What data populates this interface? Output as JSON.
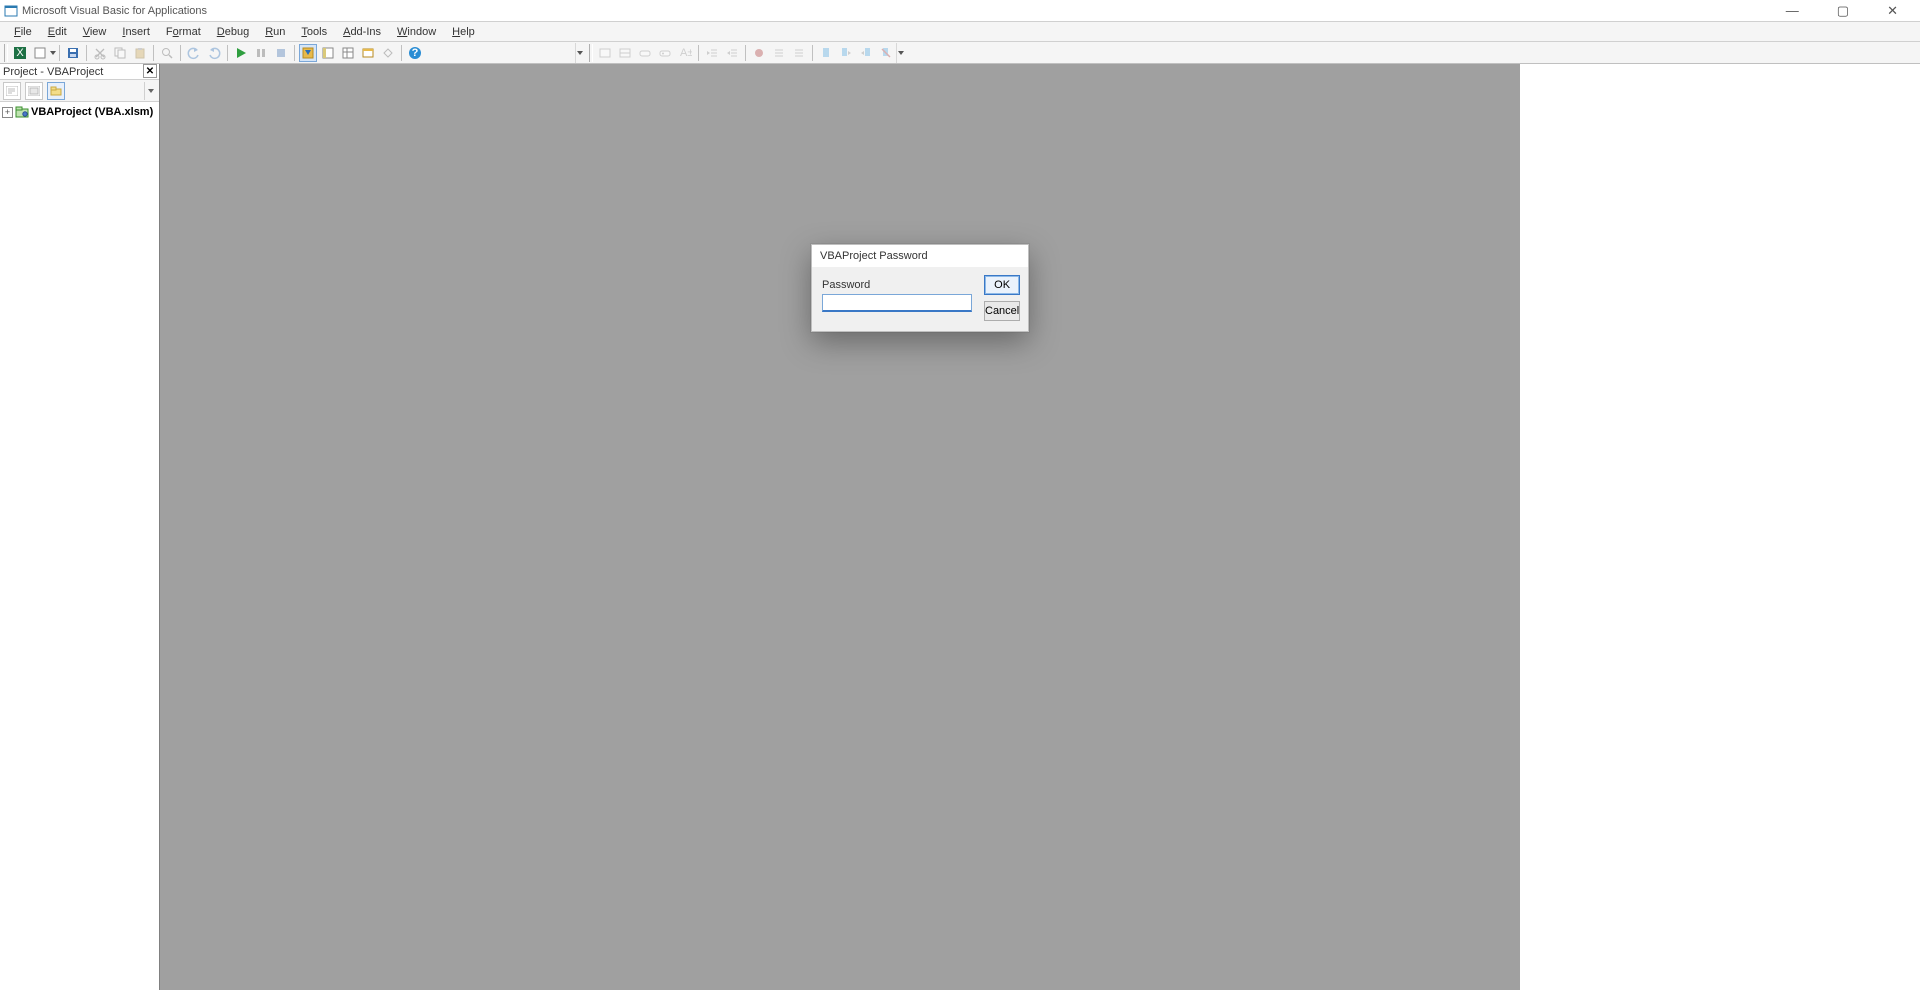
{
  "titlebar": {
    "title": "Microsoft Visual Basic for Applications"
  },
  "menu": {
    "items": [
      {
        "u": "F",
        "rest": "ile"
      },
      {
        "u": "E",
        "rest": "dit"
      },
      {
        "u": "V",
        "rest": "iew"
      },
      {
        "u": "I",
        "rest": "nsert"
      },
      {
        "u": "",
        "rest": "F",
        "tail": "ormat",
        "uIndex": 1,
        "raw": "Format",
        "uchar": "o"
      },
      {
        "u": "D",
        "rest": "ebug"
      },
      {
        "u": "R",
        "rest": "un"
      },
      {
        "u": "T",
        "rest": "ools"
      },
      {
        "u": "A",
        "rest": "dd-Ins"
      },
      {
        "u": "W",
        "rest": "indow"
      },
      {
        "u": "H",
        "rest": "elp"
      }
    ]
  },
  "project_pane": {
    "title": "Project - VBAProject",
    "tree_label": "VBAProject (VBA.xlsm)"
  },
  "dialog": {
    "title": "VBAProject Password",
    "password_label": "Password",
    "password_value": "",
    "ok": "OK",
    "cancel": "Cancel"
  }
}
